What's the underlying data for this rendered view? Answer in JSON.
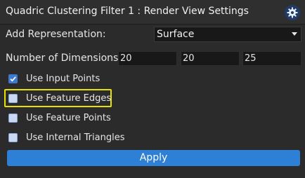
{
  "header": {
    "title": "Quadric Clustering Filter 1 : Render View Settings",
    "settings_icon": "gear-icon"
  },
  "representation": {
    "label": "Add Representation:",
    "value": "Surface"
  },
  "dimensions": {
    "label": "Number of Dimensions :",
    "values": [
      "20",
      "20",
      "25"
    ]
  },
  "options": [
    {
      "label": "Use Input Points",
      "checked": true
    },
    {
      "label": "Use Feature Edges",
      "checked": false
    },
    {
      "label": "Use Feature Points",
      "checked": false
    },
    {
      "label": "Use Internal Triangles",
      "checked": false
    }
  ],
  "actions": {
    "apply_label": "Apply"
  },
  "colors": {
    "accent": "#2e7fd6",
    "highlight": "#e8e000",
    "background": "#2b2b2b"
  }
}
